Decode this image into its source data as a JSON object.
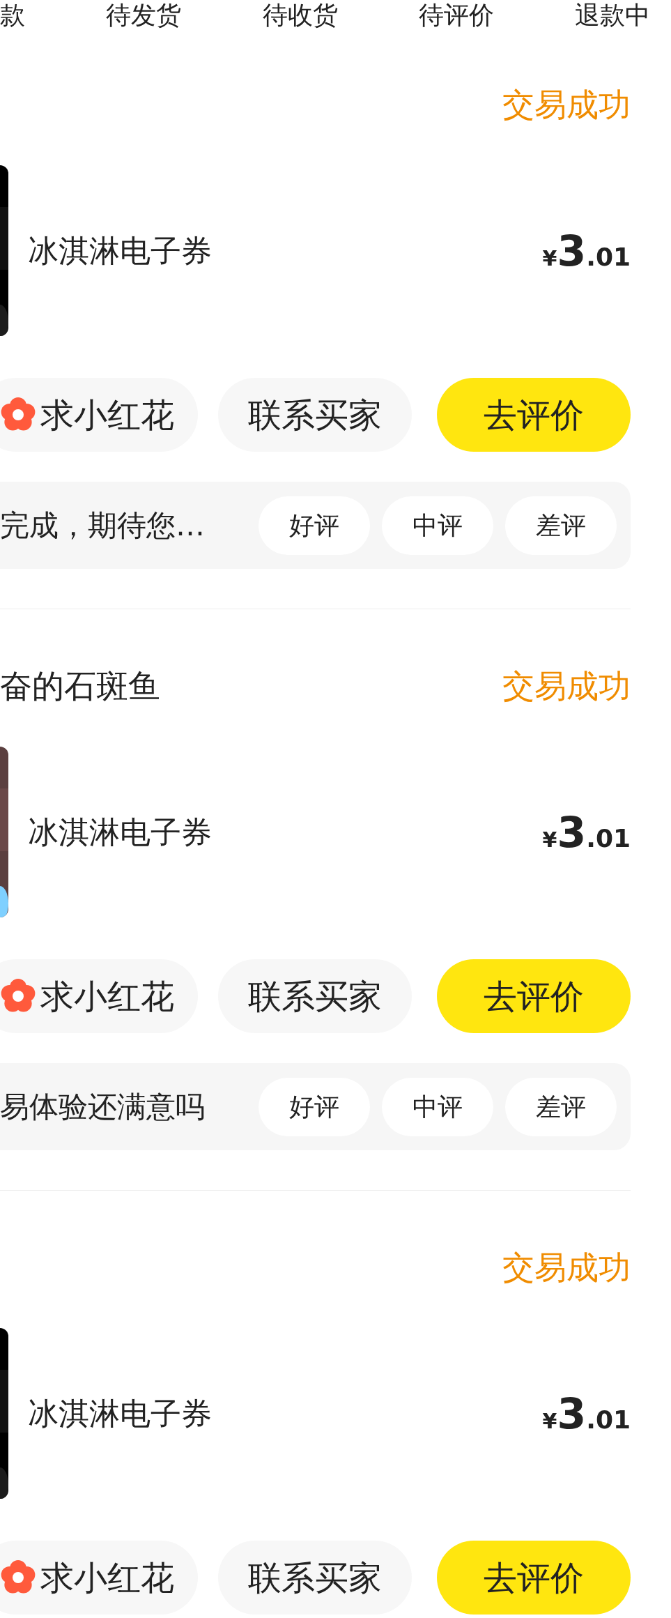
{
  "tabs": [
    {
      "label": "款"
    },
    {
      "label": "待发货"
    },
    {
      "label": "待收货"
    },
    {
      "label": "待评价"
    },
    {
      "label": "退款中"
    }
  ],
  "orders": [
    {
      "status": "交易成功",
      "title": "冰淇淋电子券",
      "price": {
        "currency": "¥",
        "integer": "3",
        "decimal": ".01"
      },
      "actions": [
        {
          "kind": "flower",
          "label": "求小红花"
        },
        {
          "kind": "plain",
          "label": "联系买家"
        },
        {
          "kind": "primary",
          "label": "去评价"
        }
      ],
      "review": {
        "prompt": "完成，期待您…",
        "options": [
          "好评",
          "中评",
          "差评"
        ]
      }
    },
    {
      "seller": "奋的石斑鱼",
      "status": "交易成功",
      "title": "冰淇淋电子券",
      "price": {
        "currency": "¥",
        "integer": "3",
        "decimal": ".01"
      },
      "actions": [
        {
          "kind": "flower",
          "label": "求小红花"
        },
        {
          "kind": "plain",
          "label": "联系买家"
        },
        {
          "kind": "primary",
          "label": "去评价"
        }
      ],
      "review": {
        "prompt": "易体验还满意吗",
        "options": [
          "好评",
          "中评",
          "差评"
        ]
      }
    },
    {
      "status": "交易成功",
      "title": "冰淇淋电子券",
      "price": {
        "currency": "¥",
        "integer": "3",
        "decimal": ".01"
      },
      "actions": [
        {
          "kind": "flower",
          "label": "求小红花"
        },
        {
          "kind": "plain",
          "label": "联系买家"
        },
        {
          "kind": "primary",
          "label": "去评价"
        }
      ]
    }
  ]
}
